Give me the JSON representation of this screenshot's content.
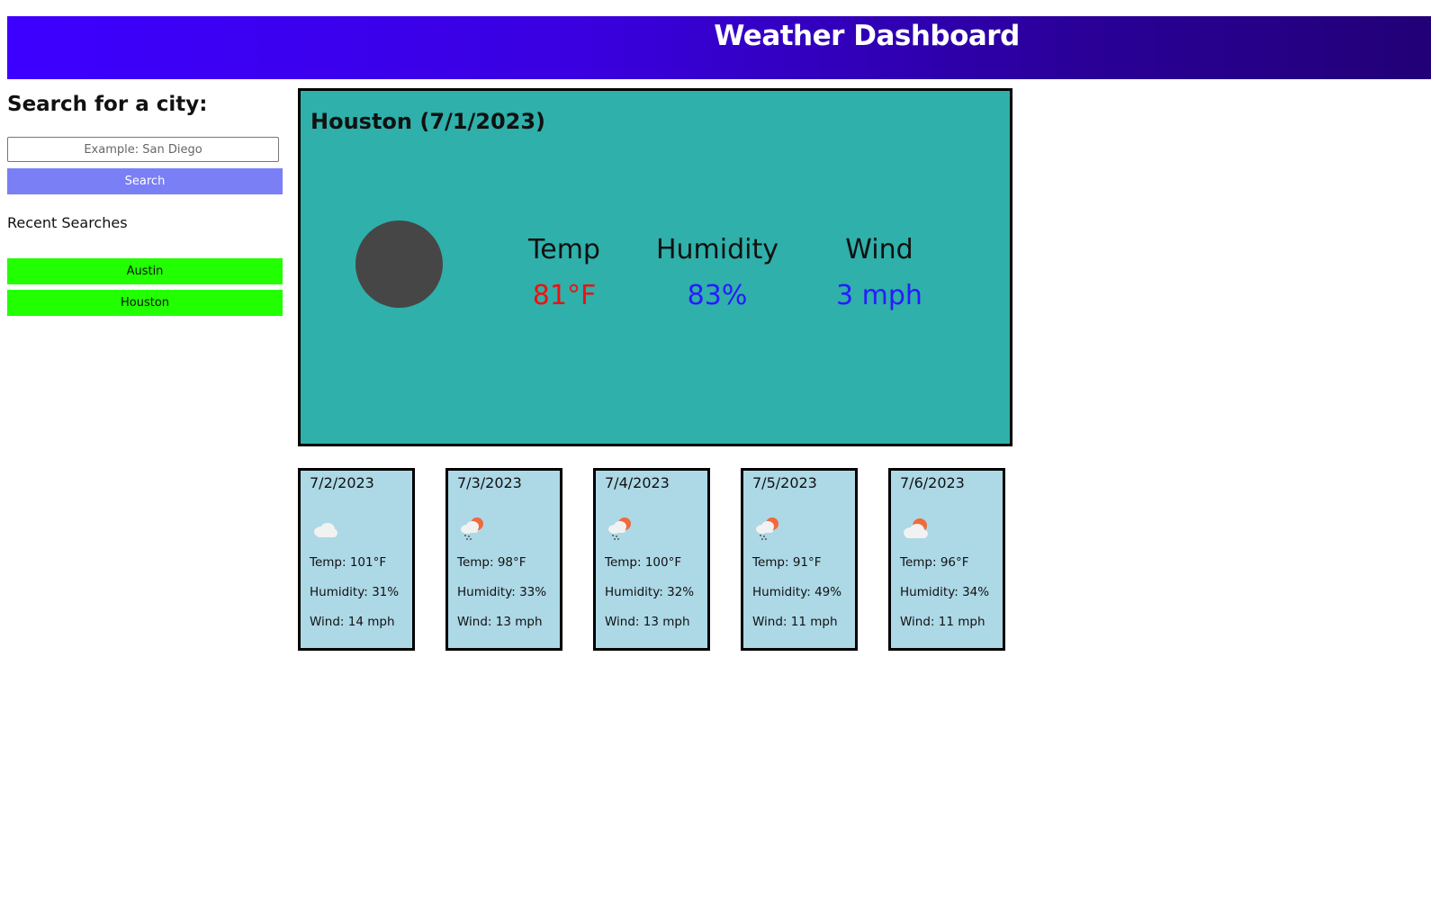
{
  "header": {
    "title": "Weather Dashboard"
  },
  "sidebar": {
    "heading": "Search for a city:",
    "search_placeholder": "Example: San Diego",
    "search_value": "",
    "search_label": "Search",
    "recent_heading": "Recent Searches",
    "history": [
      {
        "label": "Austin"
      },
      {
        "label": "Houston"
      }
    ]
  },
  "today": {
    "title": "Houston (7/1/2023)",
    "icon": "weather-icon-placeholder",
    "temp_label": "Temp",
    "temp_value": "81°F",
    "humidity_label": "Humidity",
    "humidity_value": "83%",
    "wind_label": "Wind",
    "wind_value": "3 mph"
  },
  "forecast": [
    {
      "date": "7/2/2023",
      "icon": "cloud-icon",
      "temp": "Temp: 101°F",
      "humidity": "Humidity: 31%",
      "wind": "Wind: 14 mph"
    },
    {
      "date": "7/3/2023",
      "icon": "sun-rain-cloud-icon",
      "temp": "Temp: 98°F",
      "humidity": "Humidity: 33%",
      "wind": "Wind: 13 mph"
    },
    {
      "date": "7/4/2023",
      "icon": "sun-rain-cloud-icon",
      "temp": "Temp: 100°F",
      "humidity": "Humidity: 32%",
      "wind": "Wind: 13 mph"
    },
    {
      "date": "7/5/2023",
      "icon": "sun-rain-cloud-icon",
      "temp": "Temp: 91°F",
      "humidity": "Humidity: 49%",
      "wind": "Wind: 11 mph"
    },
    {
      "date": "7/6/2023",
      "icon": "sun-cloud-icon",
      "temp": "Temp: 96°F",
      "humidity": "Humidity: 34%",
      "wind": "Wind: 11 mph"
    }
  ],
  "colors": {
    "header_gradient_start": "#3d00ff",
    "header_gradient_end": "#220077",
    "search_button": "#7b7ff5",
    "history_button": "#22ff00",
    "today_card": "#2fb0aa",
    "forecast_card": "#add8e6",
    "temp_value": "#ee1111",
    "humidity_value": "#2a1aff",
    "wind_value": "#2a1aff"
  }
}
